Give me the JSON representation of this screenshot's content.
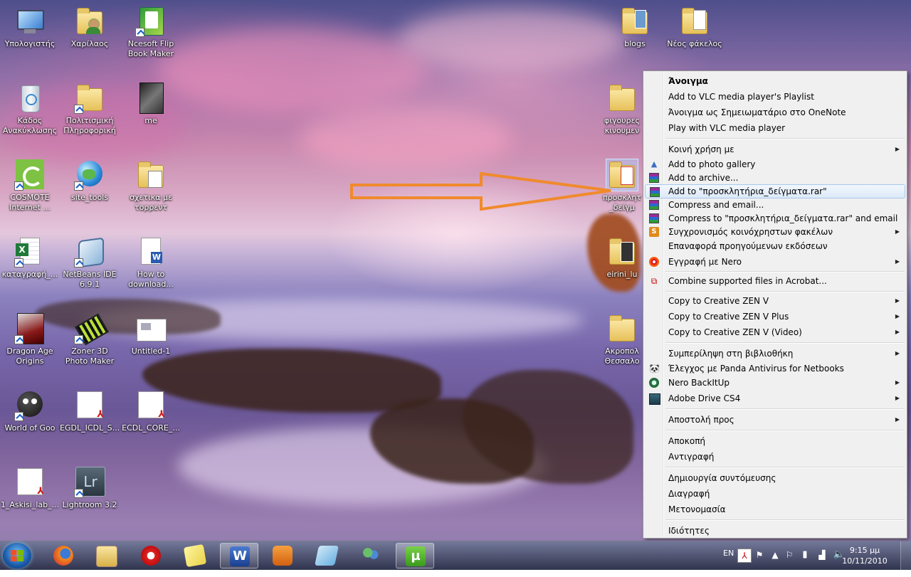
{
  "desktop": {
    "icons": [
      {
        "label": "Υπολογιστής"
      },
      {
        "label": "Χαρίλαος"
      },
      {
        "label": "Ncesoft Flip\nBook Maker"
      },
      {
        "label": "Κάδος\nΑνακύκλωσης"
      },
      {
        "label": "Πολιτισμική\nΠληροφορική"
      },
      {
        "label": "me"
      },
      {
        "label": "COSMOTE\nInternet ..."
      },
      {
        "label": "site_tools"
      },
      {
        "label": "σχετικα με\nτορρεντ"
      },
      {
        "label": "καταγραφή_..."
      },
      {
        "label": "NetBeans IDE\n6.9.1"
      },
      {
        "label": "How to\ndownload..."
      },
      {
        "label": "Dragon Age\nOrigins"
      },
      {
        "label": "Zoner 3D\nPhoto Maker"
      },
      {
        "label": "Untitled-1"
      },
      {
        "label": "World of Goo"
      },
      {
        "label": "EGDL_ICDL_S..."
      },
      {
        "label": "ECDL_CORE_..."
      },
      {
        "label": "1_Askisi_lab_..."
      },
      {
        "label": "Lightroom 3.2"
      },
      {
        "label": "blogs"
      },
      {
        "label": "Νέος φάκελος"
      },
      {
        "label": "φιγουρες\nκινουμεν"
      },
      {
        "label": "προσκλητ\n_δείγμ"
      },
      {
        "label": "eirini_lu"
      },
      {
        "label": "Ακροπολ\nΘεσσαλο"
      }
    ]
  },
  "context_menu": {
    "items": [
      {
        "label": "Άνοιγμα"
      },
      {
        "label": "Add to VLC media player's Playlist"
      },
      {
        "label": "Άνοιγμα ως Σημειωματάριο στο OneNote"
      },
      {
        "label": "Play with VLC media player"
      },
      {
        "label": "Κοινή χρήση με"
      },
      {
        "label": "Add to photo gallery"
      },
      {
        "label": "Add to archive..."
      },
      {
        "label": "Add to \"προσκλητήρια_δείγματα.rar\""
      },
      {
        "label": "Compress and email..."
      },
      {
        "label": "Compress to \"προσκλητήρια_δείγματα.rar\" and email"
      },
      {
        "label": "Συγχρονισμός κοινόχρηστων φακέλων"
      },
      {
        "label": "Επαναφορά προηγούμενων εκδόσεων"
      },
      {
        "label": "Εγγραφή με Nero"
      },
      {
        "label": "Combine supported files in Acrobat..."
      },
      {
        "label": "Copy to Creative ZEN V"
      },
      {
        "label": "Copy to Creative ZEN V Plus"
      },
      {
        "label": "Copy to Creative ZEN V (Video)"
      },
      {
        "label": "Συμπερίληψη στη βιβλιοθήκη"
      },
      {
        "label": "Έλεγχος με Panda Antivirus for Netbooks"
      },
      {
        "label": "Nero BackItUp"
      },
      {
        "label": "Adobe Drive CS4"
      },
      {
        "label": "Αποστολή προς"
      },
      {
        "label": "Αποκοπή"
      },
      {
        "label": "Αντιγραφή"
      },
      {
        "label": "Δημιουργία συντόμευσης"
      },
      {
        "label": "Διαγραφή"
      },
      {
        "label": "Μετονομασία"
      },
      {
        "label": "Ιδιότητες"
      }
    ],
    "highlighted_index": 7
  },
  "taskbar": {
    "language": "EN",
    "time": "9:15 μμ",
    "date": "10/11/2010"
  },
  "colors": {
    "arrow": "#f08a2c",
    "menu_bg": "#f0f0f0",
    "highlight_border": "#a8c8ec"
  }
}
